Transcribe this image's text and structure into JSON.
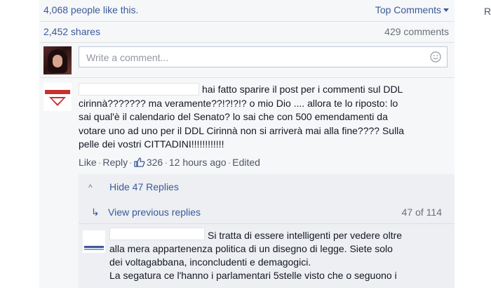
{
  "header": {
    "likes_text": "4,068 people like this.",
    "top_comments_label": "Top Comments",
    "shares_text": "2,452 shares",
    "comments_count": "429 comments"
  },
  "composer": {
    "placeholder": "Write a comment..."
  },
  "comment": {
    "lines": [
      "hai fatto sparire il post per i commenti sul DDL",
      "cirinnà??????? ma veramente??!?!?!? o mio Dio .... allora te lo riposto: lo",
      "sai qual'è il calendario del Senato? lo sai che con 500 emendamenti da",
      "votare uno ad uno per il DDL Cirinnà non si arriverà mai alla fine???? Sulla",
      "pelle dei vostri CITTADINI!!!!!!!!!!!!"
    ],
    "actions": {
      "like": "Like",
      "reply": "Reply",
      "like_count": "326",
      "time": "12 hours ago",
      "edited": "Edited"
    }
  },
  "replies": {
    "hide_label": "Hide 47 Replies",
    "view_previous": "View previous replies",
    "count": "47 of 114",
    "reply_lines": [
      "Si tratta di essere intelligenti per vedere oltre",
      "alla mera appartenenza politica di un disegno di legge. Siete solo",
      "dei voltagabbana, inconcludenti e demagogici.",
      "La segatura ce l'hanno i parlamentari 5stelle visto che o seguono i"
    ]
  },
  "side": {
    "letter": "R"
  },
  "colors": {
    "link_blue": "#3b5998",
    "panel_bg": "#f6f7f9",
    "reply_bg": "#edeff3"
  }
}
